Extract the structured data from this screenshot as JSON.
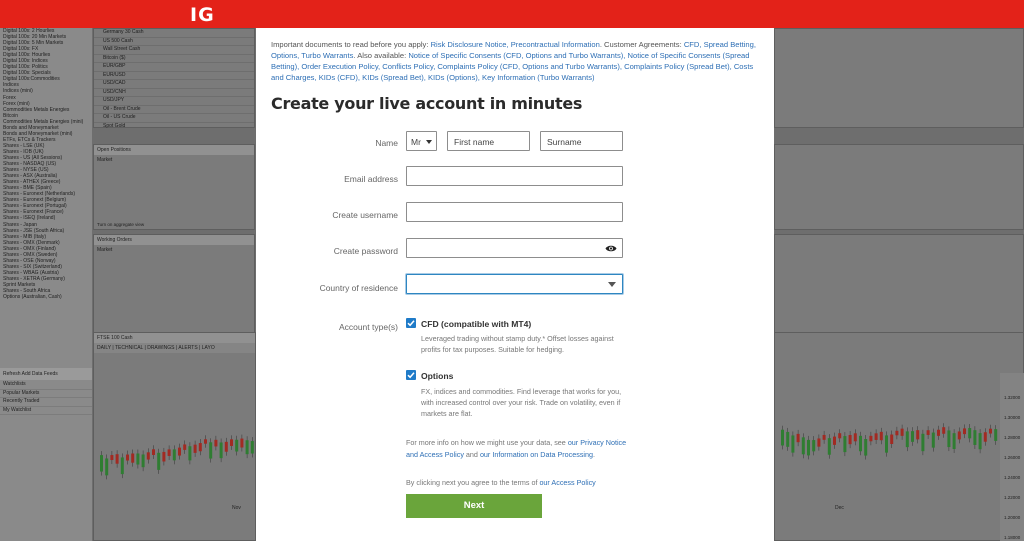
{
  "brand": {
    "logo_text": "IG",
    "color": "#e32219"
  },
  "background": {
    "markets": [
      "Digital 100s: 2 Hourlies",
      "Digital 100s: 20 Min Markets",
      "Digital 100s: 5 Min Markets",
      "Digital 100s: FX",
      "Digital 100s: Hourlies",
      "Digital 100s: Indices",
      "Digital 100s: Politics",
      "Digital 100s: Specials",
      "Digital 100s:Commodities",
      "Indices",
      "Indices (mini)",
      "Forex",
      "Forex (mini)",
      "Commodities Metals Energies",
      "Bitcoin",
      "Commodities Metals Energies (mini)",
      "Bonds and Moneymarket",
      "Bonds and Moneymarket (mini)",
      "ETFs, ETCs & Trackers",
      "Shares - LSE (UK)",
      "Shares - IOB (UK)",
      "Shares - US (All Sessions)",
      "Shares - NASDAQ (US)",
      "Shares - NYSE (US)",
      "Shares - ASX (Australia)",
      "Shares - ATHEX (Greece)",
      "Shares - BME (Spain)",
      "Shares - Euronext (Netherlands)",
      "Shares - Euronext (Belgium)",
      "Shares - Euronext (Portugal)",
      "Shares - Euronext (France)",
      "Shares - ISEQ (Ireland)",
      "Shares - Japan",
      "Shares - JSE (South Africa)",
      "Shares - MIB (Italy)",
      "Shares - OMX (Denmark)",
      "Shares - OMX (Finland)",
      "Shares - OMX (Sweden)",
      "Shares - OSE (Norway)",
      "Shares - SIX (Switzerland)",
      "Shares - WBAG (Austria)",
      "Shares - XETRA (Germany)",
      "Sprint Markets",
      "Shares - South Africa",
      "Options (Australian, Cash)"
    ],
    "tools": "Refresh   Add Data Feeds",
    "watchlists": [
      "Watchlists",
      "Popular Markets",
      "Recently Traded",
      "My Watchlist"
    ],
    "instruments": [
      "Germany 30 Cash",
      "US 500 Cash",
      "Wall Street Cash",
      "Bitcoin ($)",
      "EUR/GBP",
      "EUR/USD",
      "USD/CAD",
      "USD/CNH",
      "USD/JPY",
      "Oil - Brent Crude",
      "Oil - US Crude",
      "Spot Gold"
    ],
    "open_positions": "Open Positions",
    "working_orders": "Working Orders",
    "market_col": "Market",
    "period_col": "Peri",
    "aggregate": "Turn on aggregate view",
    "chart_title": "FTSE 100 Cash",
    "chart_toolbar": "DAILY  |  TECHNICAL  |  DRAWINGS  |  ALERTS  |  LAYO",
    "price_labels": [
      "1.32000",
      "1.30000",
      "1.28000",
      "1.26000",
      "1.24000",
      "1.22000",
      "1.20000",
      "1.18000"
    ],
    "nov_label": "Nov",
    "dec_label": "Dec"
  },
  "modal": {
    "docs": {
      "prefix": "Important documents to read before you apply: ",
      "links1": "Risk Disclosure Notice, Precontractual Information",
      "mid1": ". Customer Agreements: ",
      "links2": "CFD, Spread Betting, Options, Turbo Warrants",
      "mid2": ". Also available: ",
      "links3": "Notice of Specific Consents (CFD, Options and Turbo Warrants), Notice of Specific Consents (Spread Betting), Order Execution Policy, Conflicts Policy, Complaints Policy (CFD, Options and Turbo Warrants), Complaints Policy (Spread Bet), Costs and Charges, KIDs (CFD), KIDs (Spread Bet), KIDs (Options), Key Information (Turbo Warrants)"
    },
    "heading": "Create your live account in minutes",
    "name_label": "Name",
    "title_value": "Mr",
    "first_name_placeholder": "First name",
    "surname_placeholder": "Surname",
    "email_label": "Email address",
    "username_label": "Create username",
    "password_label": "Create password",
    "country_label": "Country of residence",
    "account_type_label": "Account type(s)",
    "options": [
      {
        "title": "CFD (compatible with MT4)",
        "desc": "Leveraged trading without stamp duty.* Offset losses against profits for tax purposes. Suitable for hedging.",
        "checked": true
      },
      {
        "title": "Options",
        "desc": "FX, indices and commodities. Find leverage that works for you, with increased control over your risk. Trade on volatility, even if markets are flat.",
        "checked": true
      }
    ],
    "privacy": {
      "prefix": "For more info on how we might use your data, see ",
      "link1": "our Privacy Notice and Access Policy",
      "mid": " and ",
      "link2": "our Information on Data Processing",
      "suffix": "."
    },
    "terms": {
      "prefix": "By clicking next you agree to the terms of ",
      "link": "our Access Policy"
    },
    "next_label": "Next",
    "colors": {
      "link": "#2e6fb5",
      "next": "#6aa53b",
      "checkbox": "#1f7bc8"
    }
  }
}
